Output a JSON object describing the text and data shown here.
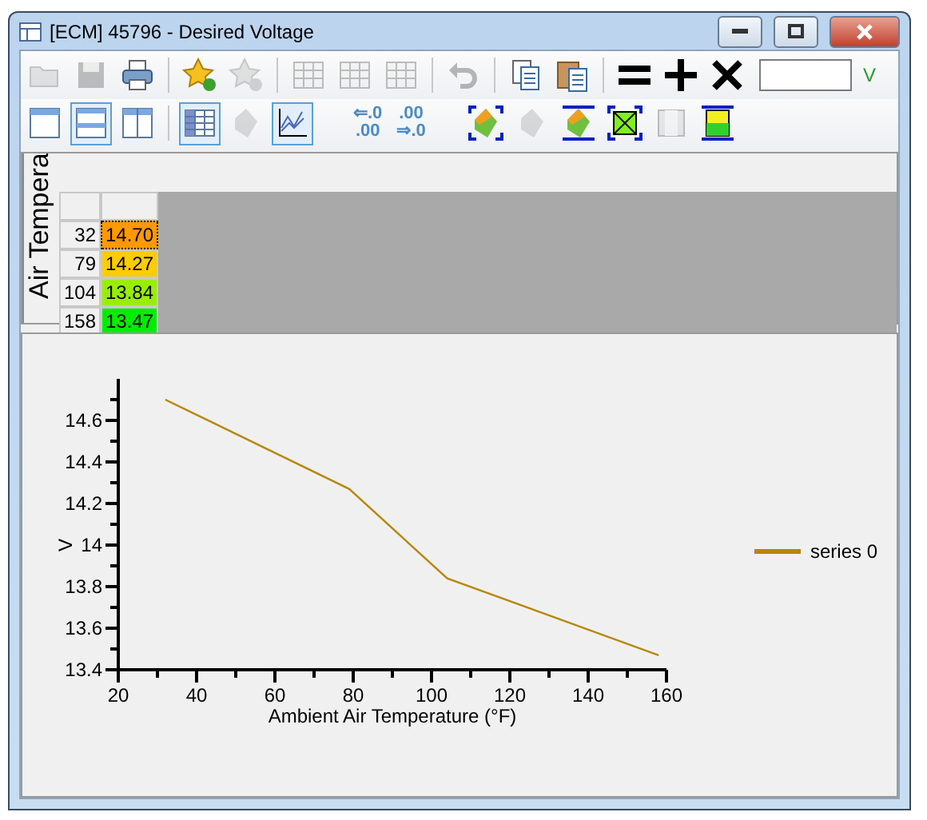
{
  "window": {
    "title": "[ECM] 45796 - Desired Voltage"
  },
  "toolbar_1": [
    {
      "kind": "open",
      "disabled": true
    },
    {
      "kind": "save",
      "disabled": true
    },
    {
      "kind": "print",
      "disabled": false
    },
    {
      "kind": "sep"
    },
    {
      "kind": "star-add",
      "disabled": false
    },
    {
      "kind": "star-remove",
      "disabled": true
    },
    {
      "kind": "sep"
    },
    {
      "kind": "table",
      "disabled": true
    },
    {
      "kind": "table",
      "disabled": true
    },
    {
      "kind": "table",
      "disabled": true
    },
    {
      "kind": "sep"
    },
    {
      "kind": "undo",
      "disabled": true
    },
    {
      "kind": "sep"
    },
    {
      "kind": "copy",
      "disabled": false
    },
    {
      "kind": "paste",
      "disabled": false
    },
    {
      "kind": "sep"
    },
    {
      "kind": "equals",
      "disabled": false
    },
    {
      "kind": "plus",
      "disabled": false
    },
    {
      "kind": "times",
      "disabled": false
    }
  ],
  "value_field": {
    "unit": "V"
  },
  "toolbar_2": [
    {
      "kind": "layout-single",
      "selected": false,
      "disabled": false
    },
    {
      "kind": "layout-rows",
      "selected": true,
      "disabled": false
    },
    {
      "kind": "layout-cols",
      "selected": false,
      "disabled": false
    },
    {
      "kind": "sep"
    },
    {
      "kind": "grid-view",
      "selected": true,
      "disabled": false
    },
    {
      "kind": "surface",
      "selected": false,
      "disabled": true
    },
    {
      "kind": "chart-view",
      "selected": true,
      "disabled": false
    },
    {
      "kind": "gap"
    },
    {
      "kind": "decimals",
      "lines": [
        "⇐.0",
        ".00"
      ],
      "selected": false,
      "disabled": false
    },
    {
      "kind": "decimals",
      "lines": [
        ".00",
        "⇒.0"
      ],
      "selected": false,
      "disabled": false
    },
    {
      "kind": "gap"
    },
    {
      "kind": "fit-corners",
      "selected": false,
      "disabled": false
    },
    {
      "kind": "surface-half",
      "selected": false,
      "disabled": true
    },
    {
      "kind": "fit-lines",
      "selected": false,
      "disabled": false
    },
    {
      "kind": "cross-box",
      "selected": false,
      "disabled": false
    },
    {
      "kind": "panel",
      "selected": false,
      "disabled": true
    },
    {
      "kind": "fill-box",
      "selected": false,
      "disabled": false
    }
  ],
  "table": {
    "axis_label": "Air Tempera",
    "rows": [
      {
        "header": "32",
        "value": "14.70",
        "color": "#ff9900",
        "selected": true
      },
      {
        "header": "79",
        "value": "14.27",
        "color": "#ffcc00",
        "selected": false
      },
      {
        "header": "104",
        "value": "13.84",
        "color": "#99ee00",
        "selected": false
      },
      {
        "header": "158",
        "value": "13.47",
        "color": "#00ee00",
        "selected": false
      }
    ]
  },
  "chart": {
    "chart_data": {
      "type": "line",
      "xlabel": "Ambient Air Temperature (°F)",
      "ylabel": "V",
      "x": [
        32,
        79,
        104,
        158
      ],
      "series": [
        {
          "name": "series 0",
          "color": "#b8860b",
          "values": [
            14.7,
            14.27,
            13.84,
            13.47
          ]
        }
      ],
      "xlim": [
        20,
        160
      ],
      "ylim": [
        13.4,
        14.8
      ],
      "xticks": [
        20,
        40,
        60,
        80,
        100,
        120,
        140,
        160
      ],
      "yticks": [
        13.4,
        13.6,
        13.8,
        {
          "value": 14,
          "label": "14"
        },
        14.2,
        14.4,
        14.6
      ]
    }
  }
}
